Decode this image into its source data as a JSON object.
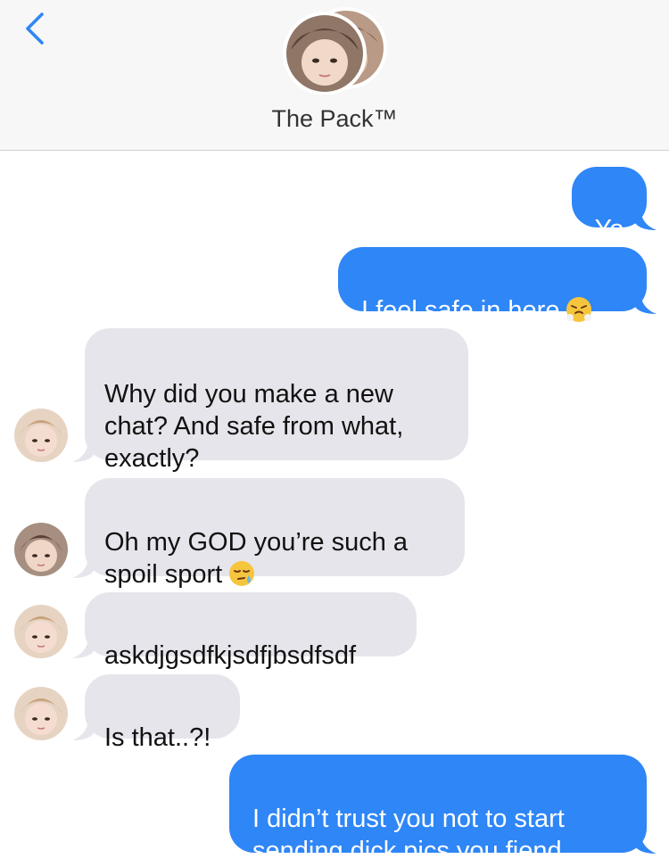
{
  "header": {
    "title": "The Pack™",
    "back_icon": "chevron-left-icon",
    "avatar_icon": "group-avatar-icon"
  },
  "colors": {
    "outgoing_bubble": "#2f86f6",
    "incoming_bubble": "#e6e5eb",
    "back_arrow": "#2f86f6"
  },
  "messages": [
    {
      "direction": "outgoing",
      "text": "Yo"
    },
    {
      "direction": "outgoing",
      "text": "I feel safe in here",
      "emoji": "face-with-steam-from-nose"
    },
    {
      "direction": "incoming",
      "sender_avatar": "avatar-blond",
      "text": "Why did you make a new\nchat? And safe from what,\nexactly?"
    },
    {
      "direction": "incoming",
      "sender_avatar": "avatar-brown",
      "text": "Oh my GOD you’re such a\nspoil sport",
      "emoji": "sleepy-face"
    },
    {
      "direction": "incoming",
      "sender_avatar": "avatar-blond",
      "text": "askdjgsdfkjsdfjbsdfsdf"
    },
    {
      "direction": "incoming",
      "sender_avatar": "avatar-blond",
      "text": "Is that..?!"
    },
    {
      "direction": "outgoing",
      "text": "I didn’t trust you not to start\nsending dick pics you fiend"
    }
  ]
}
